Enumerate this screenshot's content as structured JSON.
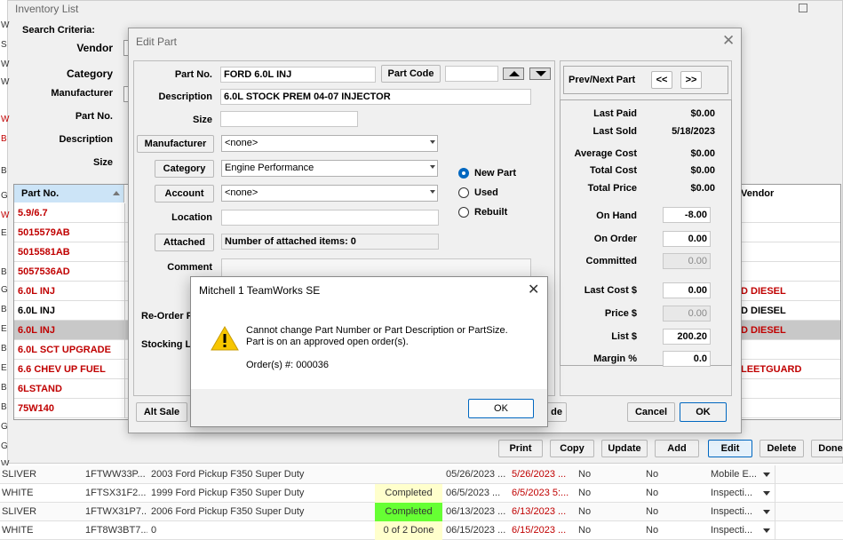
{
  "inventory": {
    "title": "Inventory List",
    "search_criteria": "Search Criteria:",
    "labels": {
      "vendor": "Vendor",
      "category": "Category",
      "manufacturer": "Manufacturer",
      "part_no": "Part No.",
      "description": "Description",
      "size": "Size"
    },
    "headers": {
      "part_no": "Part No.",
      "vendor": "Vendor"
    },
    "rows": [
      {
        "part": "5.9/6.7",
        "vendor": ""
      },
      {
        "part": "5015579AB",
        "vendor": ""
      },
      {
        "part": "5015581AB",
        "vendor": ""
      },
      {
        "part": "5057536AD",
        "vendor": ""
      },
      {
        "part": "6.0L INJ",
        "vendor": "D DIESEL"
      },
      {
        "part": "6.0L INJ",
        "vendor": "D DIESEL"
      },
      {
        "part": "6.0L INJ",
        "vendor": "D DIESEL"
      },
      {
        "part": "6.0L SCT UPGRADE",
        "vendor": ""
      },
      {
        "part": "6.6 CHEV UP FUEL",
        "vendor": "LEETGUARD"
      },
      {
        "part": "6LSTAND",
        "vendor": ""
      },
      {
        "part": "75W140",
        "vendor": ""
      }
    ],
    "buttons": {
      "print": "Print",
      "copy": "Copy",
      "update": "Update",
      "add": "Add",
      "edit": "Edit",
      "delete": "Delete",
      "done": "Done"
    },
    "left_letters": [
      "W",
      "S",
      "W",
      "W",
      "W",
      "B",
      "B",
      "G",
      "W",
      "E",
      "B",
      "G",
      "B",
      "E",
      "B",
      "E",
      "B",
      "B",
      "G",
      "G",
      "W"
    ]
  },
  "bg_table": [
    {
      "color": "SLIVER",
      "vin": "1FTWW33P...",
      "vehicle": "2003 Ford Pickup F350 Super Duty",
      "status": "",
      "date1": "05/26/2023 ...",
      "date2": "5/26/2023 ...",
      "c1": "No",
      "c2": "No",
      "type": "Mobile E..."
    },
    {
      "color": "WHITE",
      "vin": "1FTSX31F2...",
      "vehicle": "1999 Ford Pickup F350 Super Duty",
      "status": "Completed",
      "date1": "06/5/2023 ...",
      "date2": "6/5/2023 5:...",
      "c1": "No",
      "c2": "No",
      "type": "Inspecti..."
    },
    {
      "color": "SLIVER",
      "vin": "1FTWX31P7...",
      "vehicle": "2006 Ford Pickup F350 Super Duty",
      "status": "Completed",
      "date1": "06/13/2023 ...",
      "date2": "6/13/2023 ...",
      "c1": "No",
      "c2": "No",
      "type": "Inspecti..."
    },
    {
      "color": "WHITE",
      "vin": "1FT8W3BT7...",
      "vehicle": "0",
      "status": "0 of 2 Done",
      "date1": "06/15/2023 ...",
      "date2": "6/15/2023 ...",
      "c1": "No",
      "c2": "No",
      "type": "Inspecti..."
    }
  ],
  "edit_part": {
    "title": "Edit Part",
    "labels": {
      "part_no": "Part No.",
      "description": "Description",
      "size": "Size",
      "location": "Location",
      "comment": "Comment",
      "reorder": "Re-Order P",
      "stocking": "Stocking L"
    },
    "buttons": {
      "part_code": "Part Code",
      "manufacturer": "Manufacturer",
      "category": "Category",
      "account": "Account",
      "attached": "Attached",
      "alt_sale": "Alt Sale",
      "code_partial": "de",
      "cancel": "Cancel",
      "ok": "OK",
      "prev": "<<",
      "next": ">>"
    },
    "values": {
      "part_no": "FORD 6.0L INJ",
      "part_code": "",
      "description": "6.0L STOCK PREM 04-07 INJECTOR",
      "size": "",
      "manufacturer": "<none>",
      "category": "Engine Performance",
      "account": "<none>",
      "location": "",
      "attached": "Number of attached items: 0",
      "comment": ""
    },
    "radios": {
      "new": "New Part",
      "used": "Used",
      "rebuilt": "Rebuilt"
    },
    "prevnext": "Prev/Next Part",
    "stats": [
      {
        "label": "Last Paid",
        "value": "$0.00"
      },
      {
        "label": "Last Sold",
        "value": "5/18/2023"
      },
      {
        "label": "Average Cost",
        "value": "$0.00"
      },
      {
        "label": "Total Cost",
        "value": "$0.00"
      },
      {
        "label": "Total Price",
        "value": "$0.00"
      }
    ],
    "stock": {
      "on_hand_label": "On Hand",
      "on_hand": "-8.00",
      "on_order_label": "On Order",
      "on_order": "0.00",
      "committed_label": "Committed",
      "committed": "0.00"
    },
    "pricing": {
      "last_cost_label": "Last Cost $",
      "last_cost": "0.00",
      "price_label": "Price $",
      "price": "0.00",
      "list_label": "List $",
      "list": "200.20",
      "margin_label": "Margin %",
      "margin": "0.0"
    }
  },
  "alert": {
    "title": "Mitchell 1 TeamWorks SE",
    "line1": "Cannot change Part Number or Part Description or PartSize.",
    "line2": "Part is on an approved open order(s).",
    "orders": "Order(s) #: 000036",
    "ok": "OK"
  }
}
